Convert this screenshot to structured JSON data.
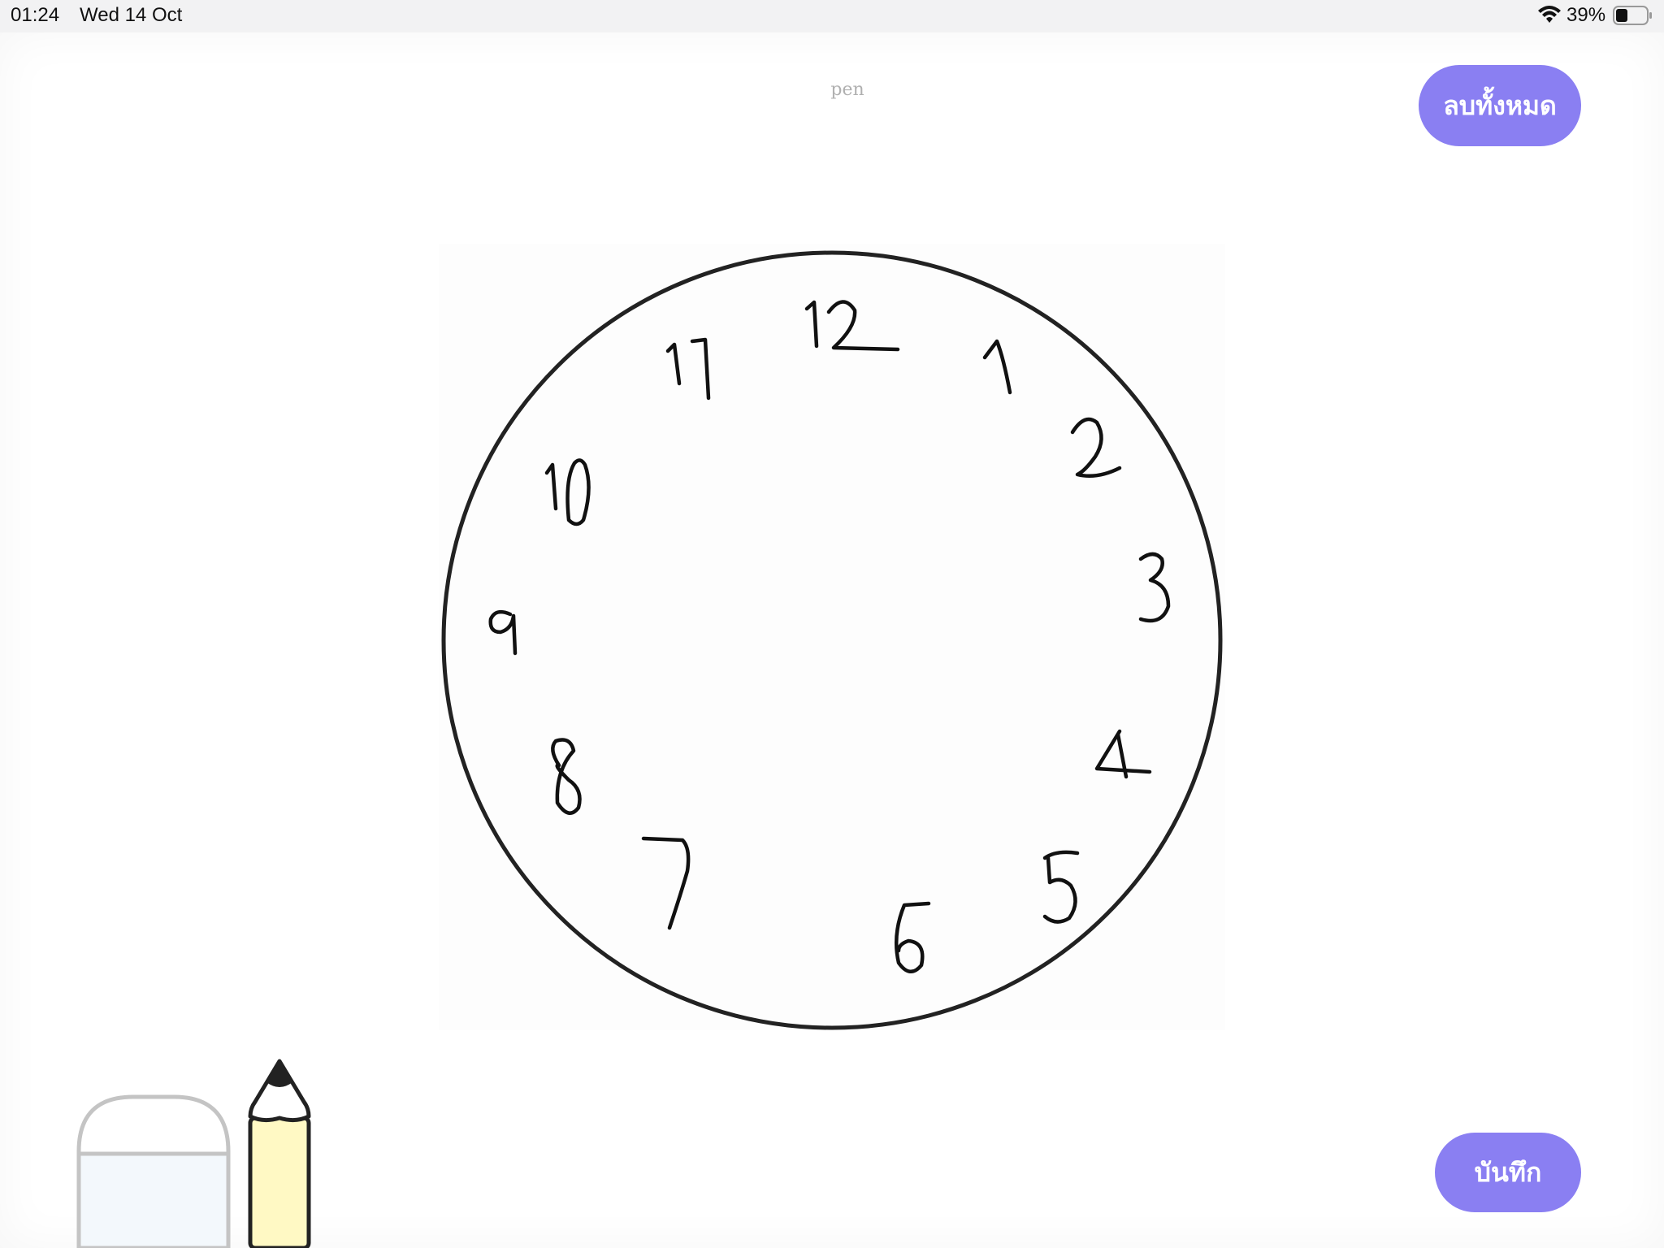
{
  "status_bar": {
    "time": "01:24",
    "date": "Wed 14 Oct",
    "battery_percent": "39%",
    "battery_level": 0.39
  },
  "toolbar": {
    "current_tool_label": "pen",
    "clear_all_label": "ลบทั้งหมด",
    "save_label": "บันทึก"
  },
  "colors": {
    "accent": "#8a7ff2",
    "ink": "#111111",
    "eraser_fill": "#f3f8fc",
    "pencil_body": "#fff9c4"
  },
  "tools": {
    "eraser_icon": "eraser-icon",
    "pencil_icon": "pencil-icon"
  }
}
